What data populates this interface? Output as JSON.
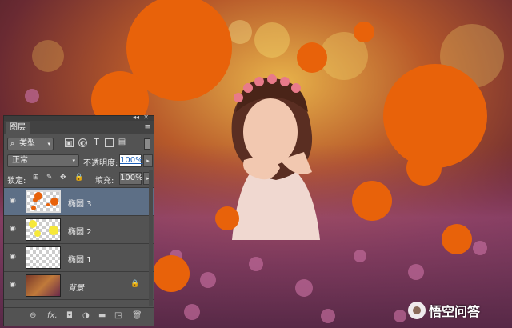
{
  "canvas": {
    "overlay_color": "#e8620a"
  },
  "layers_panel": {
    "tab_label": "图层",
    "filter_label": "类型",
    "blend_mode": "正常",
    "opacity_label": "不透明度:",
    "opacity_value": "100%",
    "lock_label": "锁定:",
    "fill_label": "填充:",
    "fill_value": "100%",
    "layers": [
      {
        "name": "椭圆 3",
        "selected": true,
        "thumb": "orange-circles"
      },
      {
        "name": "椭圆 2",
        "selected": false,
        "thumb": "yellow-circles"
      },
      {
        "name": "椭圆 1",
        "selected": false,
        "thumb": "transparent"
      },
      {
        "name": "背景",
        "selected": false,
        "thumb": "photo",
        "locked": true
      }
    ],
    "filter_icons": [
      "image-filter-icon",
      "adjustment-filter-icon",
      "type-filter-icon",
      "shape-filter-icon",
      "smart-object-filter-icon"
    ],
    "bottom_icons": [
      "link-layers-icon",
      "fx-icon",
      "mask-icon",
      "adjustment-layer-icon",
      "group-folder-icon",
      "new-layer-icon",
      "trash-icon"
    ]
  },
  "watermark": {
    "text": "悟空问答"
  }
}
